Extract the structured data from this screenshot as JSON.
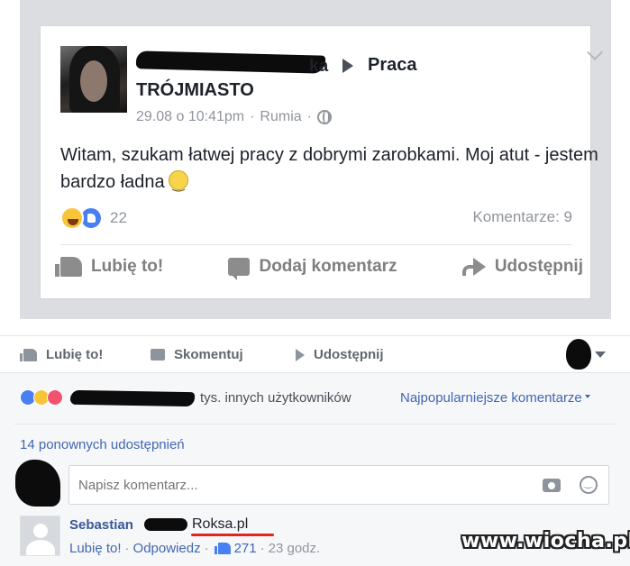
{
  "shared_post": {
    "author_visible_suffix": "ka",
    "destination_group": "Praca",
    "group_name": "TRÓJMIASTO",
    "timestamp": "29.08 o 10:41pm",
    "location": "Rumia",
    "separator": "·",
    "text": "Witam,  szukam łatwej pracy z dobrymi zarobkami. Moj atut - jestem bardzo ładna",
    "reaction_count": "22",
    "comments_label": "Komentarze: 9",
    "actions": {
      "like": "Lubię to!",
      "comment": "Dodaj komentarz",
      "share": "Udostępnij"
    }
  },
  "outer_actions": {
    "like": "Lubię to!",
    "comment": "Skomentuj",
    "share": "Udostępnij"
  },
  "reactions_summary": {
    "others_text": "tys. innych użytkowników",
    "sort_label": "Najpopularniejsze komentarze"
  },
  "shares_count": "14 ponownych udostępnień",
  "comment_input": {
    "placeholder": "Napisz komentarz..."
  },
  "top_comment": {
    "author_first": "Sebastian",
    "text": "Roksa.pl",
    "like_label": "Lubię to!",
    "reply_label": "Odpowiedz",
    "likes": "271",
    "time": "23 godz.",
    "separator": "·"
  },
  "watermark": "www.wiocha.pl",
  "colors": {
    "link": "#4267b2",
    "name": "#365899",
    "underline": "#e2261f"
  }
}
